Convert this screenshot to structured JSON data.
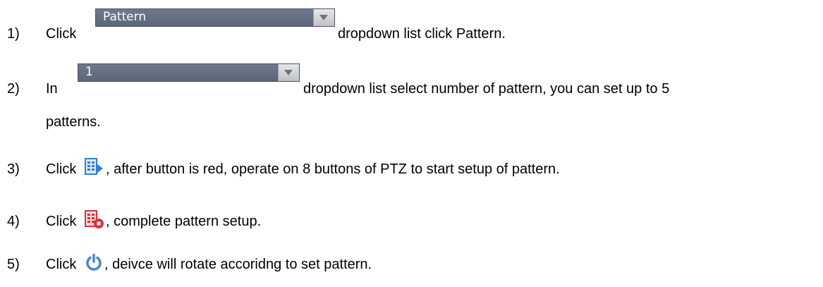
{
  "steps": [
    {
      "num": "1)",
      "before": "Click",
      "dropdown_value": "Pattern",
      "after": "dropdown list click Pattern."
    },
    {
      "num": "2)",
      "before": "In",
      "dropdown_value": "1",
      "after": "dropdown list select number of pattern, you can set up to 5",
      "continuation": "patterns."
    },
    {
      "num": "3)",
      "before": "Click",
      "icon": "record-pattern-icon",
      "after": ", after button is red, operate on 8 buttons of PTZ to start setup of pattern."
    },
    {
      "num": "4)",
      "before": "Click",
      "icon": "stop-record-pattern-icon",
      "after": ", complete pattern setup."
    },
    {
      "num": "5)",
      "before": "Click",
      "icon": "power-icon",
      "after": ", deivce will  rotate accoridng to set pattern."
    }
  ],
  "colors": {
    "dropdown_fill": "#66707f",
    "record_icon": "#2f7fd6",
    "stop_icon": "#d9333a",
    "power_icon": "#4a86d2"
  }
}
